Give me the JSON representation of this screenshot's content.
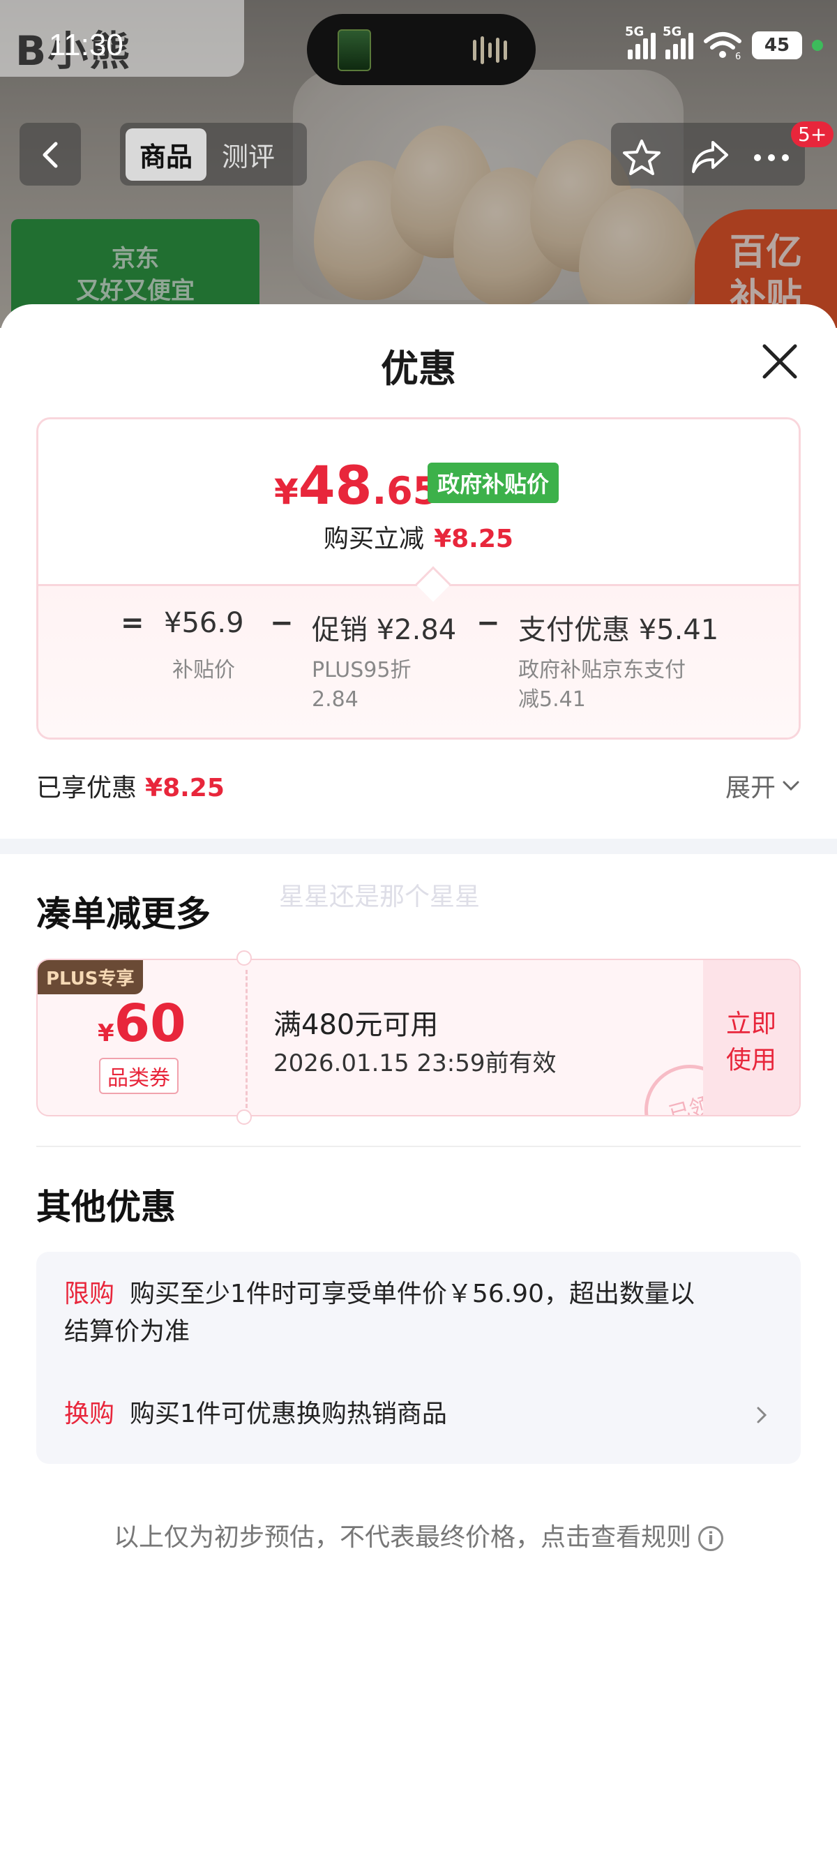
{
  "status_bar": {
    "time": "11:30",
    "app_watermark": "B小熊",
    "signal1": "5G",
    "signal2": "5G",
    "wifi_sub": "6",
    "battery": "45"
  },
  "product_nav": {
    "tab_active": "商品",
    "tab_inactive": "测评",
    "message_badge": "5+"
  },
  "background_badges": {
    "jd_line1": "京东",
    "jd_line2": "又好又便宜",
    "subsidy_line1": "百亿",
    "subsidy_line2": "补贴"
  },
  "sheet": {
    "title": "优惠"
  },
  "price_summary": {
    "currency": "¥",
    "price_int": "48",
    "price_dec": ".65",
    "price_tag": "政府补贴价",
    "instant_label": "购买立减",
    "instant_amount": "¥8.25",
    "eq": "=",
    "subsidy_price": "¥56.9",
    "subsidy_price_label": "补贴价",
    "minus1": "−",
    "promo": "促销 ¥2.84",
    "promo_desc_line1": "PLUS95折",
    "promo_desc_line2": "2.84",
    "minus2": "−",
    "pay_discount": "支付优惠 ¥5.41",
    "pay_desc_line1": "政府补贴京东支付",
    "pay_desc_line2": "减5.41"
  },
  "enjoyed": {
    "label": "已享优惠",
    "amount": "¥8.25",
    "expand_label": "展开"
  },
  "more_section": {
    "title": "凑单减更多",
    "overlay_text": "星星还是那个星星"
  },
  "coupon": {
    "plus_tag": "PLUS专享",
    "currency": "¥",
    "amount": "60",
    "category": "品类券",
    "condition": "满480元可用",
    "validity": "2026.01.15 23:59前有效",
    "use_line1": "立即",
    "use_line2": "使用",
    "stamp": "已领"
  },
  "other_section": {
    "title": "其他优惠",
    "items": [
      {
        "key": "限购",
        "text": "购买至少1件时可享受单件价￥56.90，超出数量以",
        "text2": "结算价为准"
      },
      {
        "key": "换购",
        "text": "购买1件可优惠换购热销商品"
      }
    ]
  },
  "footer": {
    "note": "以上仅为初步预估，不代表最终价格，点击查看规则",
    "info_symbol": "i"
  }
}
